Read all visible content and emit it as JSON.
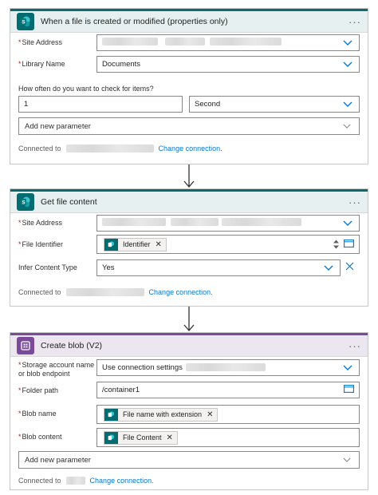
{
  "trigger": {
    "title": "When a file is created or modified (properties only)",
    "more": "···",
    "site_address_label": "Site Address",
    "library_name_label": "Library Name",
    "library_name_value": "Documents",
    "frequency_label": "How often do you want to check for items?",
    "interval_value": "1",
    "unit_value": "Second",
    "add_param": "Add new parameter",
    "connected_to": "Connected to",
    "change_connection": "Change connection."
  },
  "getfile": {
    "title": "Get file content",
    "more": "···",
    "site_address_label": "Site Address",
    "file_identifier_label": "File Identifier",
    "identifier_token": "Identifier",
    "infer_label": "Infer Content Type",
    "infer_value": "Yes",
    "connected_to": "Connected to",
    "change_connection": "Change connection."
  },
  "blob": {
    "title": "Create blob (V2)",
    "more": "···",
    "storage_label_line1": "Storage account name",
    "storage_label_line2": "or blob endpoint",
    "storage_value": "Use connection settings",
    "folder_label": "Folder path",
    "folder_value": "/container1",
    "blob_name_label": "Blob name",
    "blob_name_token": "File name with extension",
    "blob_content_label": "Blob content",
    "blob_content_token": "File Content",
    "add_param": "Add new parameter",
    "connected_to": "Connected to",
    "change_connection": "Change connection."
  },
  "colors": {
    "sharepoint": "#036c70",
    "azure_blob": "#7a4b99",
    "link": "#0078d4",
    "required": "#a4262c"
  },
  "icons": [
    "sharepoint-icon",
    "azure-blob-icon",
    "chevron-down-icon",
    "folder-picker-icon",
    "remove-token-icon",
    "clear-icon",
    "more-icon",
    "down-arrow-icon",
    "spin-arrows-icon"
  ]
}
